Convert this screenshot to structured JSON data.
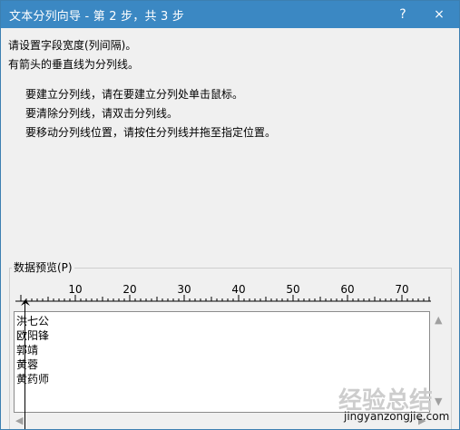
{
  "window": {
    "title": "文本分列向导 - 第 2 步，共 3 步",
    "help": "?",
    "close": "×"
  },
  "instructions": {
    "line1": "请设置字段宽度(列间隔)。",
    "line2": "有箭头的垂直线为分列线。",
    "bullets": [
      "要建立分列线，请在要建立分列处单击鼠标。",
      "要清除分列线，请双击分列线。",
      "要移动分列线位置，请按住分列线并拖至指定位置。"
    ]
  },
  "preview": {
    "label": "数据预览(P)",
    "ruler_ticks": [
      "10",
      "20",
      "30",
      "40",
      "50",
      "60",
      "70"
    ],
    "rows": [
      "洪七公",
      "欧阳锋",
      "郭靖",
      "黄蓉",
      "黄药师"
    ]
  },
  "scrollbar": {
    "up": "▲",
    "down": "▼",
    "left": "◀",
    "right": "▶"
  },
  "watermark": {
    "logo_text": "经验总结",
    "url": "jingyanzongjie.com"
  }
}
